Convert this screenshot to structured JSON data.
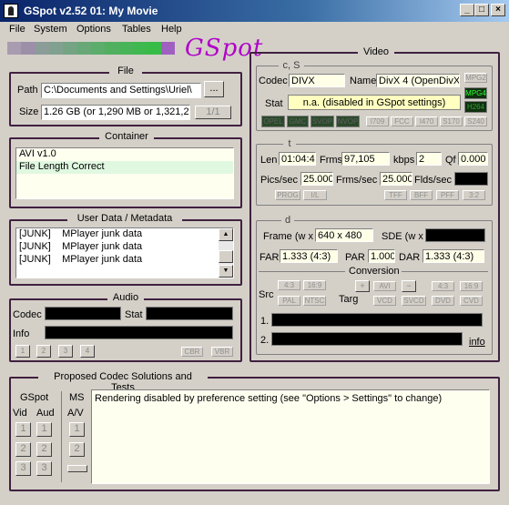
{
  "window": {
    "title": "GSpot v2.52 ​01: My Movie",
    "min": "_",
    "max": "□",
    "close": "×"
  },
  "menu": [
    "File",
    "System",
    "Options",
    "Tables",
    "Help"
  ],
  "logo": "GSpot",
  "file": {
    "title": "File",
    "path_label": "Path",
    "path_value": "C:\\Documents and Settings\\Uriel\\",
    "browse": "...",
    "size_label": "Size",
    "size_value": "1.26 GB (or 1,290 MB or 1,321,29",
    "page": "1/1"
  },
  "container": {
    "title": "Container",
    "rows": [
      "AVI v1.0",
      "File Length Correct"
    ]
  },
  "userdata": {
    "title": "User Data / Metadata",
    "rows": [
      {
        "tag": "[JUNK]",
        "text": "MPlayer junk data"
      },
      {
        "tag": "[JUNK]",
        "text": "MPlayer junk data"
      },
      {
        "tag": "[JUNK]",
        "text": "MPlayer junk data"
      }
    ]
  },
  "audio": {
    "title": "Audio",
    "codec_label": "Codec",
    "stat_label": "Stat",
    "info_label": "Info",
    "streams": [
      "1",
      "2",
      "3",
      "4"
    ],
    "cbr": "CBR",
    "vbr": "VBR"
  },
  "video": {
    "title": "Video",
    "cs_title": "c, S",
    "codec_label": "Codec",
    "codec_value": "DIVX",
    "name_label": "Name",
    "name_value": "DivX 4 (OpenDivX)",
    "stat_label": "Stat",
    "stat_value": "n.a. (disabled in GSpot settings)",
    "tag_mpg2": "MPG2",
    "tag_mpg4": "MPG4",
    "tag_h264": "H264",
    "dark_tags": [
      "OPEL",
      "GMC",
      "SVOP",
      "NVOP"
    ],
    "grey_tags": [
      "I709",
      "FCC",
      "I470",
      "S170",
      "S240"
    ],
    "t_title": "t",
    "len_label": "Len",
    "len_value": "01:04:44",
    "frms_label": "Frms",
    "frms_value": "97,105",
    "kbps_label": "kbps",
    "kbps_value": "2",
    "qf_label": "Qf",
    "qf_value": "0.000",
    "pics_label": "Pics/sec",
    "pics_value": "25.000",
    "frms_sec_label": "Frms/sec",
    "frms_sec_value": "25.000",
    "flds_label": "Flds/sec",
    "t_tags_left": [
      "PROG",
      "I/L"
    ],
    "t_tags_right": [
      "TFF",
      "BFF",
      "PFF",
      "3:2"
    ],
    "d_title": "d",
    "frame_label": "Frame (w x",
    "frame_value": "640 x 480",
    "sde_label": "SDE (w x",
    "far_label": "FAR",
    "far_value": "1.333 (4:3)",
    "par_label": "PAR",
    "par_value": "1.000",
    "dar_label": "DAR",
    "dar_value": "1.333 (4:3)",
    "conversion_title": "Conversion",
    "src_label": "Src",
    "targ_label": "Targ",
    "src_tags": [
      "4:3",
      "16:9",
      "PAL",
      "NTSC"
    ],
    "conv_tags_top": [
      "+",
      "AVI",
      "−",
      "4:3",
      "16:9"
    ],
    "conv_tags_bot": [
      "VCD",
      "SVCD",
      "DVD",
      "CVD"
    ],
    "row1_label": "1.",
    "row2_label": "2.",
    "info_link": "info"
  },
  "proposed": {
    "title": "Proposed Codec Solutions and Tests",
    "gspot_label": "GSpot",
    "ms_label": "MS",
    "vid_label": "Vid",
    "aud_label": "Aud",
    "av_label": "A/V",
    "message": "Rendering disabled by preference setting (see \"Options > Settings\" to change)",
    "nums": [
      "1",
      "2",
      "3"
    ]
  },
  "colors": {
    "title_bar": "#0a246a",
    "group_border": "#402040",
    "logo": "#b000c8",
    "yellow_field": "#ffffc0",
    "gradient": [
      "#a89cb0",
      "#9c90a8",
      "#8c9c98",
      "#80a090",
      "#74a484",
      "#68a878",
      "#5cac6c",
      "#50b060",
      "#48b458",
      "#40b850",
      "#38bc48",
      "#a060c0"
    ]
  }
}
